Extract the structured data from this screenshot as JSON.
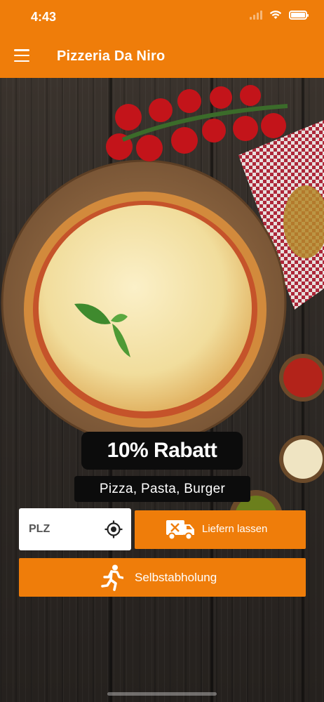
{
  "status_bar": {
    "time": "4:43"
  },
  "header": {
    "title": "Pizzeria Da Niro"
  },
  "hero": {
    "promo": "10% Rabatt",
    "subtitle": "Pizza, Pasta, Burger"
  },
  "form": {
    "plz_placeholder": "PLZ",
    "plz_value": "",
    "deliver_label": "Liefern lassen",
    "pickup_label": "Selbstabholung"
  },
  "colors": {
    "accent": "#ef7d0a",
    "pill_bg": "#0c0c0c"
  },
  "icons": {
    "menu": "hamburger-icon",
    "locate": "crosshair-icon",
    "deliver": "delivery-truck-icon",
    "pickup": "running-person-icon"
  }
}
